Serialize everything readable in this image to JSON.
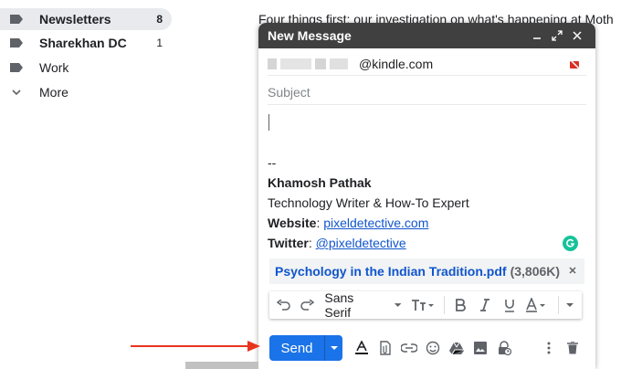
{
  "sidebar": {
    "items": [
      {
        "label": "Newsletters",
        "count": "8",
        "active": true,
        "bold": true,
        "icon": "label-icon"
      },
      {
        "label": "Sharekhan DC",
        "count": "1",
        "active": false,
        "bold": true,
        "icon": "label-icon"
      },
      {
        "label": "Work",
        "count": "",
        "active": false,
        "bold": false,
        "icon": "label-icon"
      },
      {
        "label": "More",
        "count": "",
        "active": false,
        "bold": false,
        "icon": "chevron-down-icon"
      }
    ]
  },
  "background_email": {
    "snippet": "Four things first: our investigation on what's happening at Moth"
  },
  "compose": {
    "title": "New Message",
    "to_value": "@kindle.com",
    "subject_placeholder": "Subject",
    "signature": {
      "dashes": "--",
      "name": "Khamosh Pathak",
      "role": "Technology Writer & How-To Expert",
      "website_label": "Website",
      "website_value": "pixeldetective.com",
      "twitter_label": "Twitter",
      "twitter_value": "@pixeldetective",
      "separator": ": "
    },
    "attachment": {
      "name": "Psychology in the Indian Tradition.pdf",
      "size": "(3,806K)"
    },
    "formatting": {
      "font": "Sans Serif"
    },
    "send_label": "Send"
  },
  "colors": {
    "send_blue": "#1a73e8",
    "titlebar": "#404040",
    "link": "#1155cc",
    "arrow": "#e8341c",
    "grammarly": "#15c39a"
  }
}
